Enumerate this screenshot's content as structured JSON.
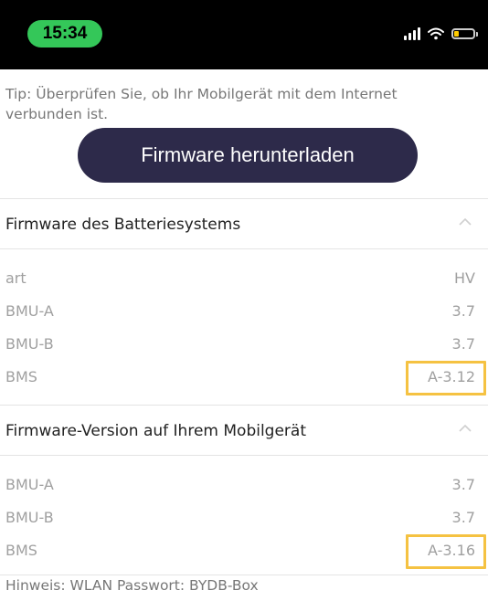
{
  "status_bar": {
    "time": "15:34"
  },
  "tip": "Tip: Überprüfen Sie, ob Ihr Mobilgerät mit dem Internet verbunden ist.",
  "download_button": "Firmware herunterladen",
  "battery_section": {
    "title": "Firmware des Batteriesystems",
    "rows": [
      {
        "label": "art",
        "value": "HV"
      },
      {
        "label": "BMU-A",
        "value": "3.7"
      },
      {
        "label": "BMU-B",
        "value": "3.7"
      },
      {
        "label": "BMS",
        "value": "A-3.12"
      }
    ]
  },
  "device_section": {
    "title": "Firmware-Version auf Ihrem Mobilgerät",
    "rows": [
      {
        "label": "BMU-A",
        "value": "3.7"
      },
      {
        "label": "BMU-B",
        "value": "3.7"
      },
      {
        "label": "BMS",
        "value": "A-3.16"
      }
    ]
  },
  "hint": "Hinweis: WLAN Passwort: BYDB-Box",
  "colors": {
    "time_pill": "#34c759",
    "button_bg": "#2d2a4a",
    "highlight": "#f5c242"
  },
  "icons": {
    "signal": "signal-icon",
    "wifi": "wifi-icon",
    "battery": "battery-icon",
    "chevron": "chevron-up-icon"
  }
}
